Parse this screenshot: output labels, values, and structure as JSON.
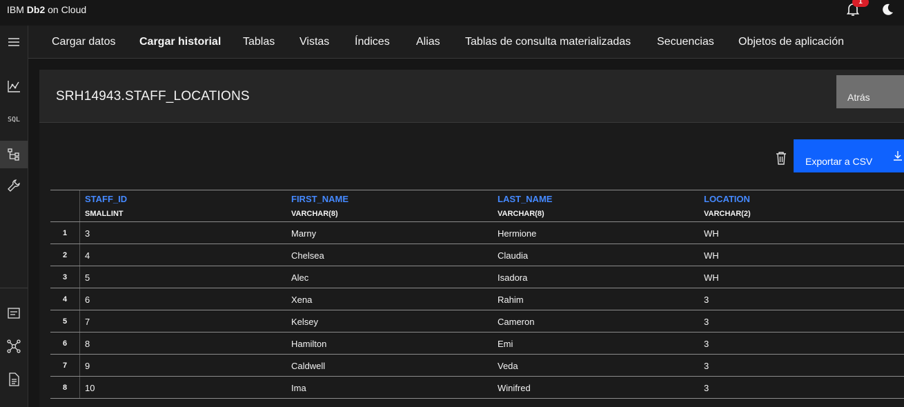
{
  "app": {
    "brand_prefix": "IBM ",
    "brand_bold": "Db2",
    "brand_suffix": " on Cloud",
    "notification_count": "1"
  },
  "rail": {
    "sql_label": "SQL"
  },
  "nav": {
    "tabs": [
      {
        "label": "Cargar datos"
      },
      {
        "label": "Cargar historial"
      },
      {
        "label": "Tablas"
      },
      {
        "label": "Vistas"
      },
      {
        "label": "Índices"
      },
      {
        "label": "Alias"
      },
      {
        "label": "Tablas de consulta materializadas"
      },
      {
        "label": "Secuencias"
      },
      {
        "label": "Objetos de aplicación"
      }
    ]
  },
  "panel": {
    "table_name": "SRH14943.STAFF_LOCATIONS",
    "back_label": "Atrás",
    "export_label": "Exportar a CSV"
  },
  "table": {
    "columns": [
      {
        "name": "STAFF_ID",
        "type": "SMALLINT"
      },
      {
        "name": "FIRST_NAME",
        "type": "VARCHAR(8)"
      },
      {
        "name": "LAST_NAME",
        "type": "VARCHAR(8)"
      },
      {
        "name": "LOCATION",
        "type": "VARCHAR(2)"
      }
    ],
    "rows": [
      {
        "n": "1",
        "cells": [
          "3",
          "Marny",
          "Hermione",
          "WH"
        ]
      },
      {
        "n": "2",
        "cells": [
          "4",
          "Chelsea",
          "Claudia",
          "WH"
        ]
      },
      {
        "n": "3",
        "cells": [
          "5",
          "Alec",
          "Isadora",
          "WH"
        ]
      },
      {
        "n": "4",
        "cells": [
          "6",
          "Xena",
          "Rahim",
          "3"
        ]
      },
      {
        "n": "5",
        "cells": [
          "7",
          "Kelsey",
          "Cameron",
          "3"
        ]
      },
      {
        "n": "6",
        "cells": [
          "8",
          "Hamilton",
          "Emi",
          "3"
        ]
      },
      {
        "n": "7",
        "cells": [
          "9",
          "Caldwell",
          "Veda",
          "3"
        ]
      },
      {
        "n": "8",
        "cells": [
          "10",
          "Ima",
          "Winifred",
          "3"
        ]
      }
    ]
  },
  "colors": {
    "accent": "#0f62fe",
    "link": "#4589ff",
    "badge": "#da1e28"
  }
}
